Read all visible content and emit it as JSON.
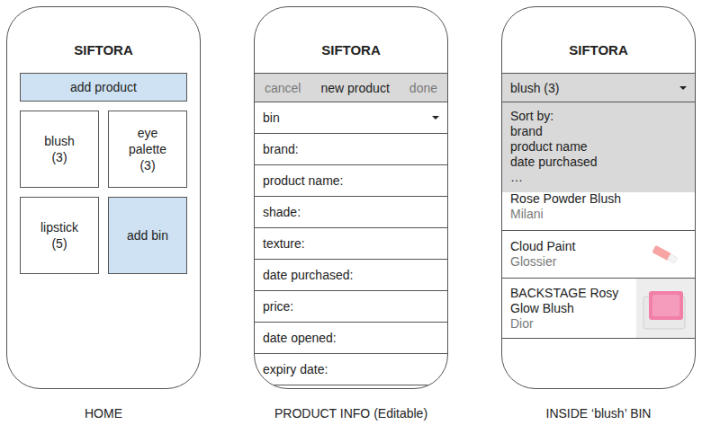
{
  "home": {
    "caption": "HOME",
    "title": "SIFTORA",
    "add_button": "add product",
    "bins": [
      {
        "label": "blush",
        "count": "(3)",
        "kind": "bin"
      },
      {
        "label": "eye palette",
        "count": "(3)",
        "kind": "bin"
      },
      {
        "label": "lipstick",
        "count": "(5)",
        "kind": "bin"
      },
      {
        "label": "add bin",
        "count": "",
        "kind": "action"
      }
    ]
  },
  "product_info": {
    "caption": "PRODUCT INFO (Editable)",
    "title": "SIFTORA",
    "header": {
      "cancel": {
        "label": "cancel",
        "disabled": true
      },
      "heading": "new product",
      "done": {
        "label": "done",
        "disabled": true
      }
    },
    "fields": [
      {
        "label": "bin",
        "kind": "dropdown"
      },
      {
        "label": "brand:",
        "kind": "text"
      },
      {
        "label": "product name:",
        "kind": "text"
      },
      {
        "label": "shade:",
        "kind": "text"
      },
      {
        "label": "texture:",
        "kind": "text"
      },
      {
        "label": "date purchased:",
        "kind": "text"
      },
      {
        "label": "price:",
        "kind": "text"
      },
      {
        "label": "date opened:",
        "kind": "text"
      },
      {
        "label": "expiry date:",
        "kind": "text"
      }
    ]
  },
  "bin_view": {
    "caption": "INSIDE ‘blush’ BIN",
    "title": "SIFTORA",
    "selector": {
      "label": "blush (3)",
      "expanded": true
    },
    "sort_menu": {
      "heading": "Sort by:",
      "options": [
        "brand",
        "product name",
        "date purchased",
        "…"
      ]
    },
    "products": [
      {
        "name": "Rose Powder Blush",
        "brand": "Milani",
        "kind": "none"
      },
      {
        "name": "Cloud Paint",
        "brand": "Glossier",
        "kind": "tube"
      },
      {
        "name": "BACKSTAGE Rosy Glow Blush",
        "brand": "Dior",
        "kind": "compact"
      }
    ]
  }
}
